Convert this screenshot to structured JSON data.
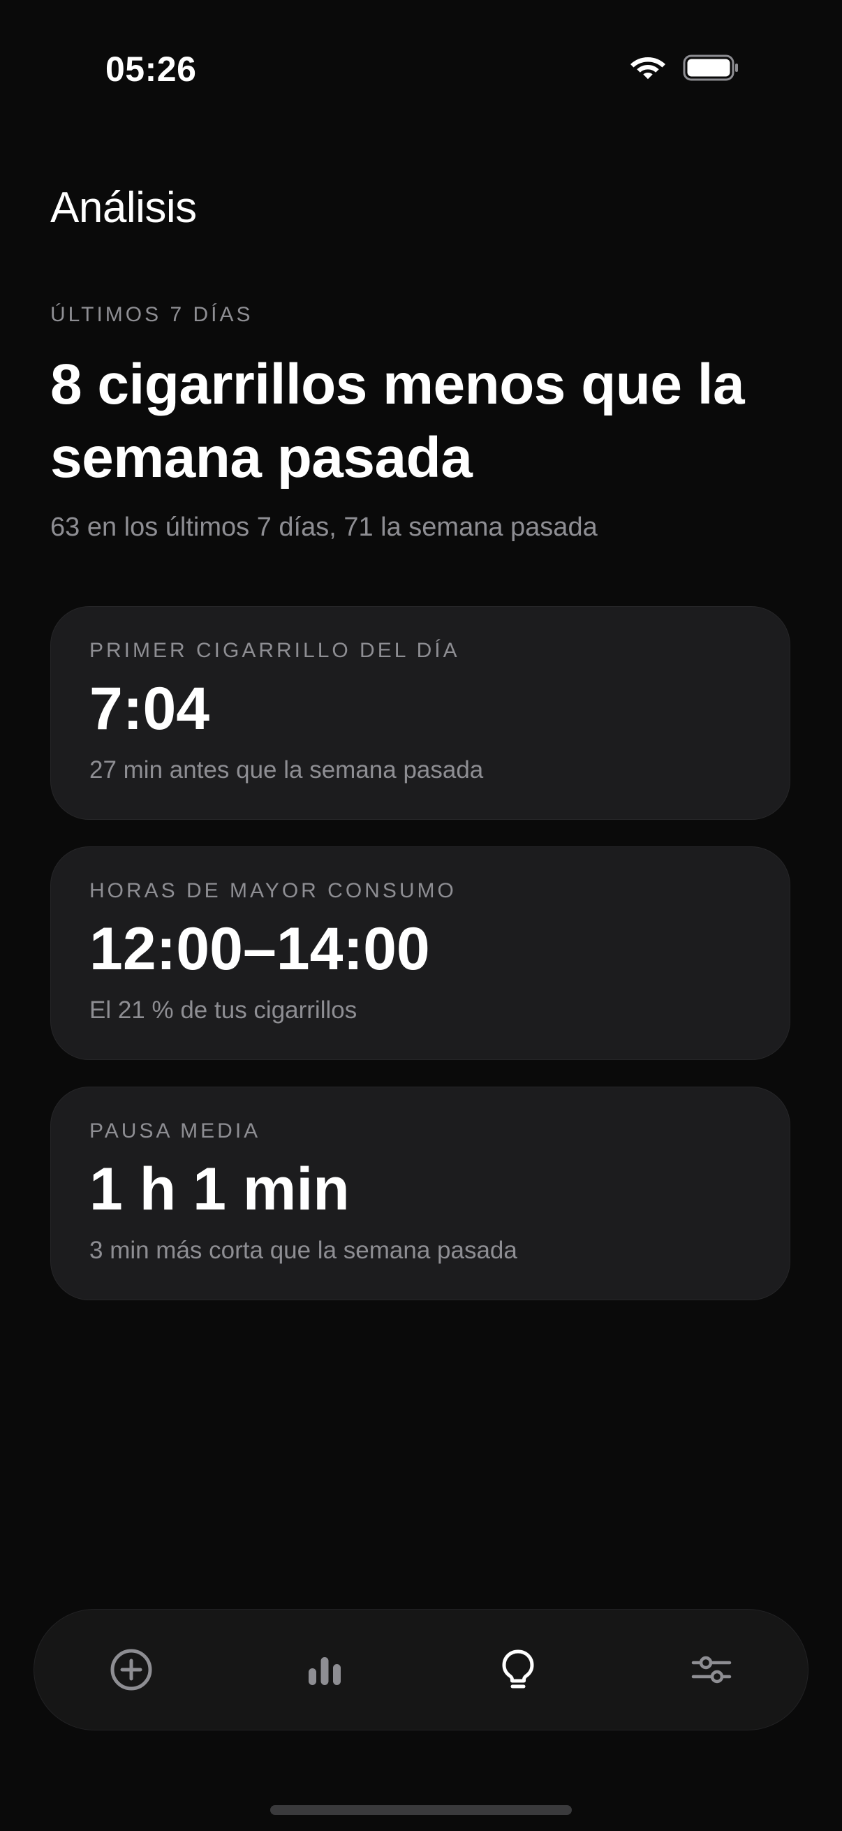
{
  "status_bar": {
    "time": "05:26",
    "wifi_icon": "wifi-icon",
    "battery_icon": "battery-icon"
  },
  "header": {
    "title": "Análisis"
  },
  "summary": {
    "period_label": "ÚLTIMOS 7 DÍAS",
    "headline": "8 cigarrillos menos que la semana pasada",
    "subtitle": "63 en los últimos 7 días, 71 la semana pasada"
  },
  "cards": [
    {
      "label": "PRIMER CIGARRILLO DEL DÍA",
      "value": "7:04",
      "note": "27 min antes que la semana pasada"
    },
    {
      "label": "HORAS DE MAYOR CONSUMO",
      "value": "12:00–14:00",
      "note": "El 21 % de tus cigarrillos"
    },
    {
      "label": "PAUSA MEDIA",
      "value": "1 h 1 min",
      "note": "3 min más corta que la semana pasada"
    }
  ],
  "tab_bar": {
    "tabs": [
      {
        "icon": "plus-circle-icon",
        "active": false
      },
      {
        "icon": "bar-chart-icon",
        "active": false
      },
      {
        "icon": "lightbulb-icon",
        "active": true
      },
      {
        "icon": "sliders-icon",
        "active": false
      }
    ],
    "active_color": "#ffffff",
    "inactive_color": "#8e8e93"
  },
  "colors": {
    "background": "#0a0a0a",
    "card": "#1c1c1e",
    "secondary_text": "#8e8e93"
  }
}
